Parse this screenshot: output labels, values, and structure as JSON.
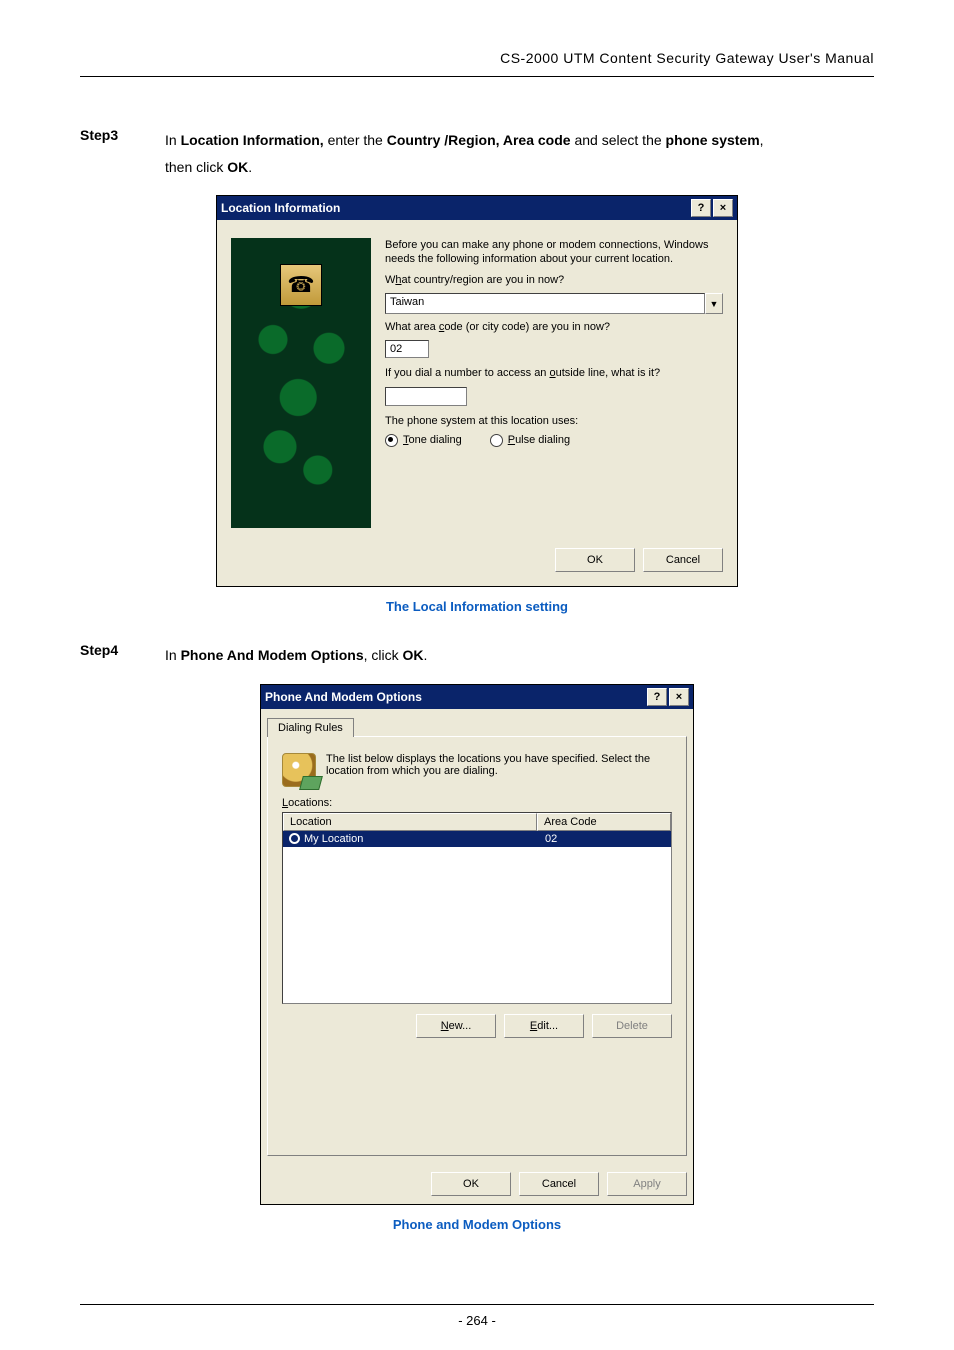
{
  "header": "CS-2000 UTM Content Security Gateway User's Manual",
  "step3": {
    "label": "Step3",
    "text_pre": "In ",
    "b1": "Location Information,",
    "t1": " enter the ",
    "b2": "Country /Region, Area code",
    "t2": " and select the ",
    "b3": "phone system",
    "t3": ",",
    "line2_pre": "then click ",
    "ok": "OK",
    "dot": "."
  },
  "locDialog": {
    "title": "Location Information",
    "p1": "Before you can make any phone or modem connections, Windows needs the following information about your current location.",
    "q_country_pre": "W",
    "q_country_u": "h",
    "q_country_post": "at country/region are you in now?",
    "country": "Taiwan",
    "q_area_pre": "What area ",
    "q_area_u": "c",
    "q_area_post": "ode (or city code) are you in now?",
    "area": "02",
    "q_outside_pre": "If you dial a number to access an ",
    "q_outside_u": "o",
    "q_outside_post": "utside line, what is it?",
    "outside": "",
    "q_phone": "The phone system at this location uses:",
    "tone_u": "T",
    "tone_post": "one dialing",
    "pulse_u": "P",
    "pulse_post": "ulse dialing",
    "ok": "OK",
    "cancel": "Cancel"
  },
  "caption1": "The Local Information setting",
  "step4": {
    "label": "Step4",
    "t0": "In ",
    "b1": "Phone And Modem Options",
    "t1": ", click ",
    "ok": "OK",
    "dot": "."
  },
  "pmDialog": {
    "title": "Phone And Modem Options",
    "tab": "Dialing Rules",
    "info": "The list below displays the locations you have specified. Select the location from which you are dialing.",
    "loc_u": "L",
    "loc_post": "ocations:",
    "colLocation": "Location",
    "colArea": "Area Code",
    "rowLocation": "My Location",
    "rowArea": "02",
    "new_u": "N",
    "new_post": "ew...",
    "edit_u": "E",
    "edit_post": "dit...",
    "delete_u": "D",
    "delete_post": "elete",
    "ok": "OK",
    "cancel": "Cancel",
    "apply": "Apply"
  },
  "caption2": "Phone and Modem Options",
  "pageNum": "- 264 -"
}
